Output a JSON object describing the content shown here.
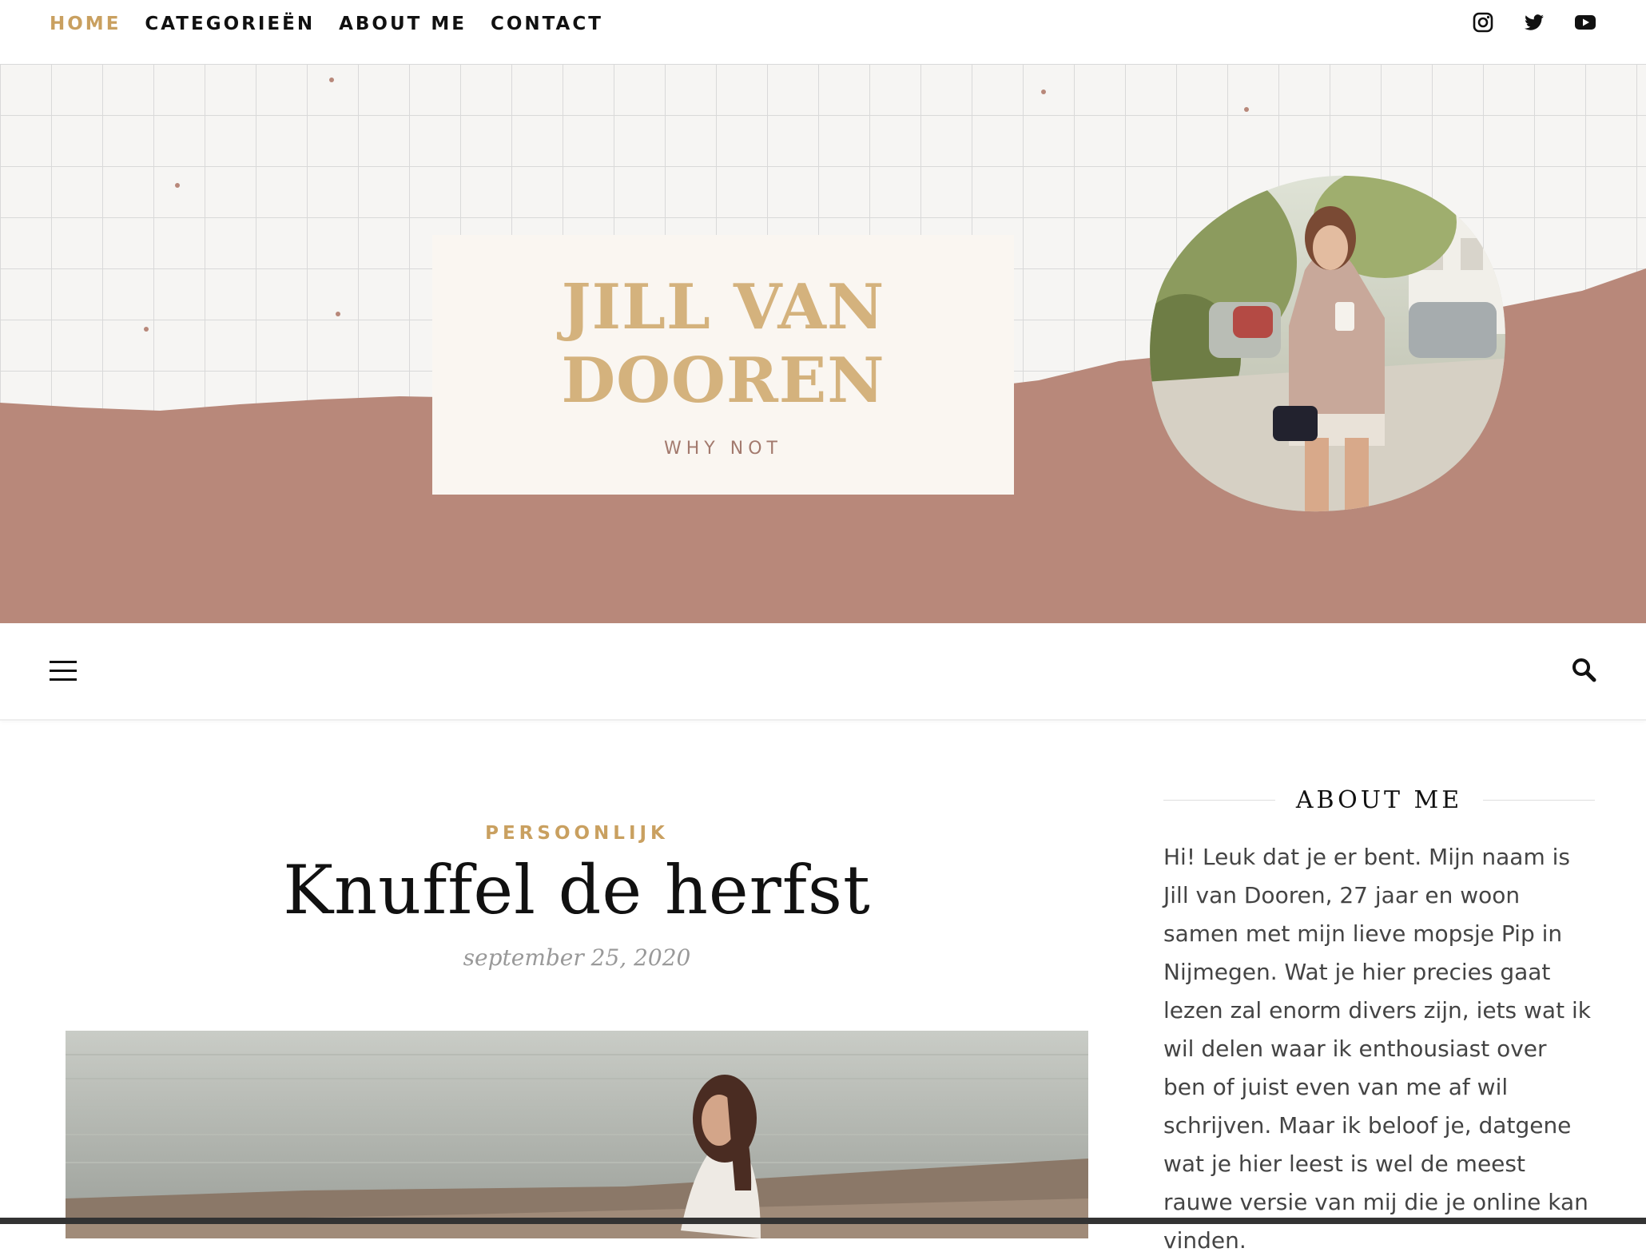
{
  "top_nav": {
    "items": [
      {
        "label": "HOME",
        "active": true
      },
      {
        "label": "CATEGORIEËN",
        "active": false
      },
      {
        "label": "ABOUT ME",
        "active": false
      },
      {
        "label": "CONTACT",
        "active": false
      }
    ]
  },
  "social": [
    "instagram-icon",
    "twitter-icon",
    "youtube-icon"
  ],
  "header": {
    "logo_line1": "JILL VAN",
    "logo_line2": "DOOREN",
    "tagline": "WHY NOT"
  },
  "post": {
    "category": "PERSOONLIJK",
    "title": "Knuffel de herfst",
    "date": "september 25, 2020"
  },
  "sidebar": {
    "widget_title": "ABOUT ME",
    "about_text": "Hi! Leuk dat je er bent. Mijn naam is Jill van Dooren, 27 jaar en woon samen met mijn lieve mopsje Pip in Nijmegen. Wat je hier precies gaat lezen zal enorm divers zijn, iets wat ik wil delen waar ik enthousiast over ben of juist even van me af wil schrijven. Maar ik beloof je, datgene wat je hier leest is wel de meest rauwe versie van mij die je online kan vinden."
  },
  "colors": {
    "accent_gold": "#c9a060",
    "banner_rose": "#b8887a",
    "logo_bg": "#faf6f1"
  }
}
